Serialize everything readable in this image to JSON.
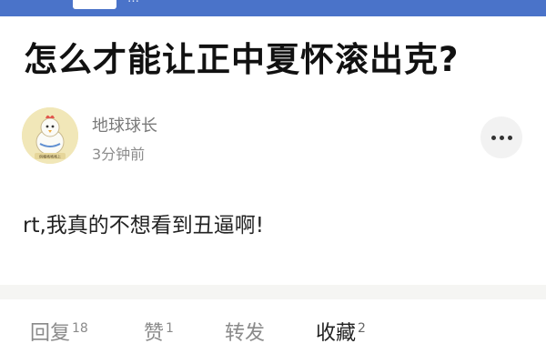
{
  "header": {
    "partial_text": "…"
  },
  "post": {
    "title": "怎么才能让正中夏怀滚出克?",
    "author": {
      "name": "地球球长",
      "avatar_caption": "俏嘴咯咯咯上"
    },
    "time": "3分钟前",
    "body": "rt,我真的不想看到丑逼啊!"
  },
  "actions": {
    "reply": {
      "label": "回复",
      "count": "18"
    },
    "like": {
      "label": "赞",
      "count": "1"
    },
    "share": {
      "label": "转发"
    },
    "favorite": {
      "label": "收藏",
      "count": "2"
    }
  },
  "icons": {
    "more": "more-horizontal-icon"
  },
  "colors": {
    "header_blue": "#4a73c9",
    "title": "#111111",
    "muted": "#8a8a8a"
  }
}
